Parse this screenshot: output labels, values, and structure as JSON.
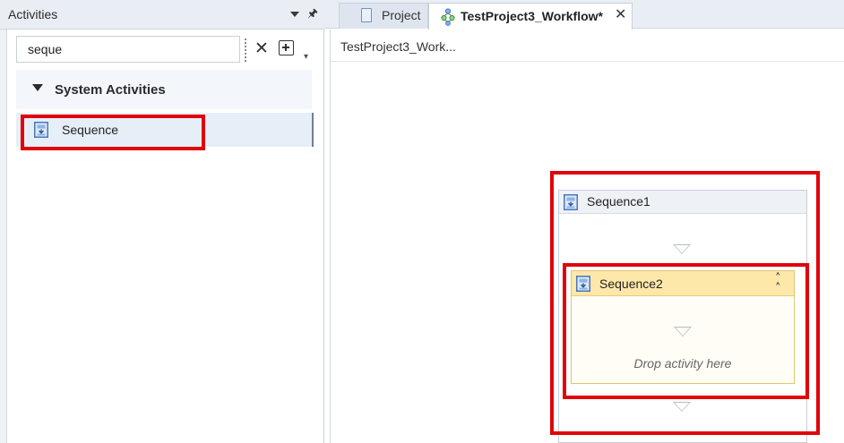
{
  "activities_panel": {
    "title": "Activities",
    "search": {
      "value": "seque",
      "placeholder": ""
    },
    "category": {
      "label": "System Activities",
      "expanded": true
    },
    "items": [
      {
        "label": "Sequence",
        "icon": "sequence-icon",
        "highlighted": true
      }
    ]
  },
  "tabs": [
    {
      "label": "Project",
      "icon": "project-icon",
      "active": false
    },
    {
      "label": "TestProject3_Workflow*",
      "icon": "workflow-icon",
      "active": true
    }
  ],
  "designer": {
    "breadcrumb": "TestProject3_Work...",
    "sequence1": {
      "title": "Sequence1"
    },
    "sequence2": {
      "title": "Sequence2",
      "placeholder": "Drop activity here"
    }
  },
  "colors": {
    "highlight": "#e0040b",
    "selected_header": "#fde8a9",
    "panel_header": "#e9eef5"
  }
}
